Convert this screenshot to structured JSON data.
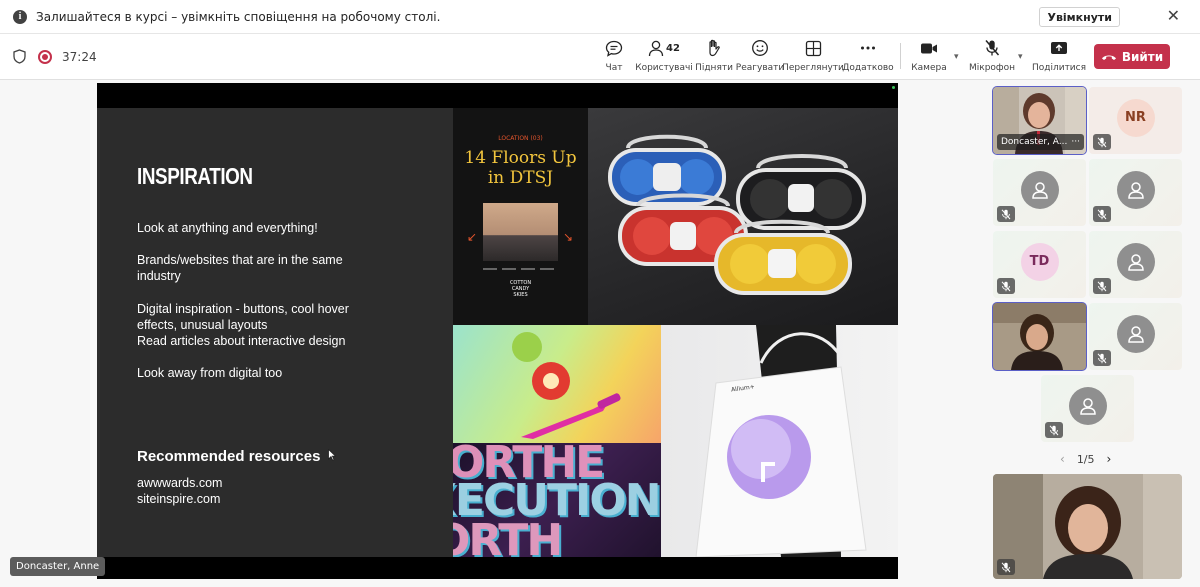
{
  "notification": {
    "text": "Залишайтеся в курсі – увімкніть сповіщення на робочому столі.",
    "enable_label": "Увімкнути",
    "close_glyph": "✕"
  },
  "toolbar": {
    "timer": "37:24",
    "participants_count": "42",
    "buttons": {
      "chat": "Чат",
      "people": "Користувачі",
      "raise": "Підняти",
      "react": "Реагувати",
      "view": "Переглянути",
      "more": "Додатково",
      "camera": "Камера",
      "mic": "Мікрофон",
      "share": "Поділитися"
    },
    "leave_label": "Вийти",
    "colors": {
      "leave": "#c4314b",
      "active_outline": "#5b5fc7"
    }
  },
  "slide": {
    "title": "INSPIRATION",
    "lines": [
      "Look at anything and everything!",
      "Brands/websites that are in the same",
      "industry",
      "Digital inspiration - buttons, cool hover",
      "effects, unusual layouts",
      "Read articles about interactive design",
      "Look away from digital too"
    ],
    "resources_title": "Recommended resources",
    "resources": [
      "awwwards.com",
      "siteinspire.com"
    ],
    "poster": {
      "location": "LOCATION (03)",
      "headline_1": "14 Floors Up",
      "headline_2": "in DTSJ",
      "cotton_1": "COTTON",
      "cotton_2": "CANDY",
      "cotton_3": "SKIES"
    },
    "bag_brand": "Allium+",
    "bag_letter": "Γ",
    "type_art": [
      "ORTHE",
      "XECUTION",
      "ORTH"
    ]
  },
  "participants": {
    "active_name": "Doncaster, A...",
    "more_glyph": "···",
    "nr_initials": "NR",
    "td_initials": "TD",
    "pager": "1/5"
  },
  "bottom_name": "Doncaster, Anne"
}
